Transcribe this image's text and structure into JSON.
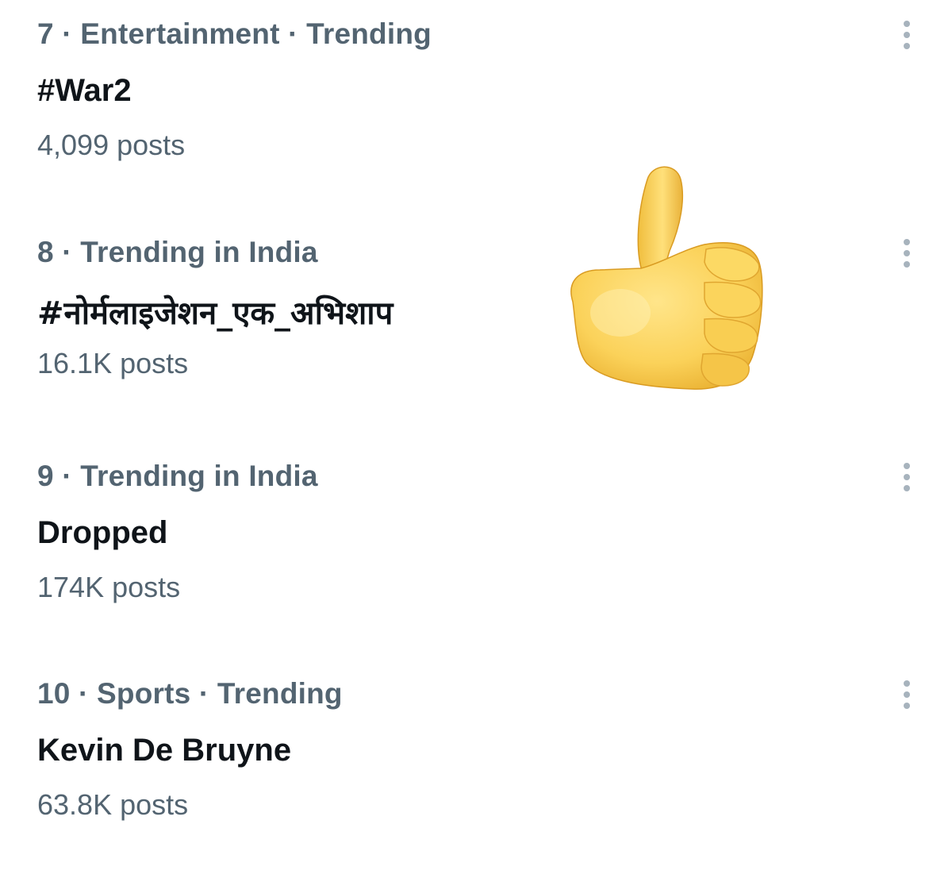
{
  "trends": [
    {
      "meta": "7 · Entertainment · Trending",
      "title": "#War2",
      "posts": "4,099 posts",
      "more_icon": "more-vertical-icon"
    },
    {
      "meta": "8 · Trending in India",
      "title": "#नोर्मलाइजेशन_एक_अभिशाप",
      "posts": "16.1K posts",
      "more_icon": "more-vertical-icon"
    },
    {
      "meta": "9 · Trending in India",
      "title": "Dropped",
      "posts": "174K posts",
      "more_icon": "more-vertical-icon"
    },
    {
      "meta": "10 · Sports · Trending",
      "title": "Kevin De Bruyne",
      "posts": "63.8K posts",
      "more_icon": "more-vertical-icon"
    }
  ],
  "overlay": {
    "icon": "thumbs-up-emoji-icon",
    "color": "#F5C542"
  },
  "colors": {
    "primary_text": "#0f1419",
    "secondary_text": "#536471",
    "more_dots": "#a7b3bd",
    "background": "#ffffff"
  }
}
